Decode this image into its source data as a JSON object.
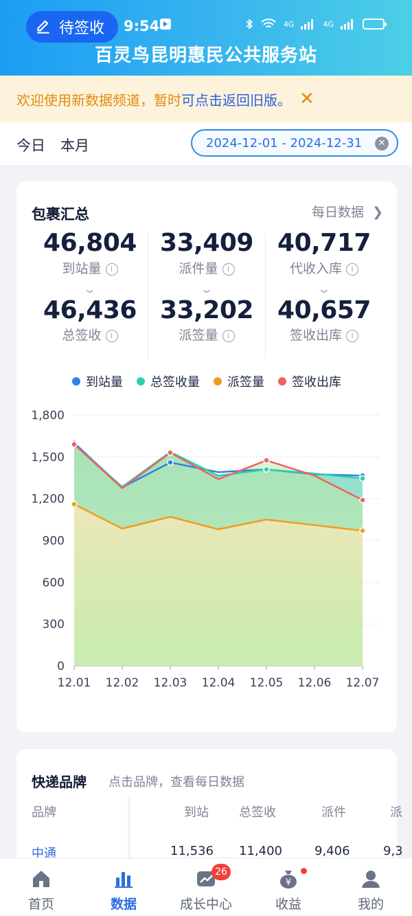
{
  "status_bar": {
    "pending_label": "待签收",
    "time": "9:54",
    "network_1": "4G",
    "network_2": "4G"
  },
  "header": {
    "title": "百灵鸟昆明惠民公共服务站"
  },
  "notice": {
    "text": "欢迎使用新数据频道，暂时",
    "link": "可点击返回旧版。",
    "close": "✕"
  },
  "date_filter": {
    "tab_today": "今日",
    "tab_month": "本月",
    "range": "2024-12-01 - 2024-12-31",
    "clear": "✕"
  },
  "summary": {
    "title": "包裹汇总",
    "daily_link": "每日数据",
    "stats": [
      {
        "value": "46,804",
        "label": "到站量"
      },
      {
        "value": "33,409",
        "label": "派件量"
      },
      {
        "value": "40,717",
        "label": "代收入库"
      },
      {
        "value": "46,436",
        "label": "总签收"
      },
      {
        "value": "33,202",
        "label": "派签量"
      },
      {
        "value": "40,657",
        "label": "签收出库"
      }
    ]
  },
  "colors": {
    "arrivals": "#2f7fe6",
    "total_signed": "#2ecfa8",
    "dispatch_signed": "#f29c1c",
    "signed_out": "#ee6363",
    "accent": "#2c6fde"
  },
  "chart_data": {
    "type": "area",
    "categories": [
      "12.01",
      "12.02",
      "12.03",
      "12.04",
      "12.05",
      "12.06",
      "12.07"
    ],
    "series": [
      {
        "name": "到站量",
        "values": [
          1600,
          1280,
          1460,
          1390,
          1410,
          1375,
          1365
        ]
      },
      {
        "name": "总签收量",
        "values": [
          1590,
          1285,
          1535,
          1365,
          1410,
          1380,
          1345
        ]
      },
      {
        "name": "派签量",
        "values": [
          1160,
          985,
          1070,
          980,
          1050,
          1010,
          970
        ]
      },
      {
        "name": "签收出库",
        "values": [
          1590,
          1275,
          1530,
          1340,
          1475,
          1365,
          1190
        ]
      }
    ],
    "ylim": [
      0,
      1800
    ],
    "yticks": [
      "0",
      "300",
      "600",
      "900",
      "1,200",
      "1,500",
      "1,800"
    ],
    "legend": "top-center",
    "grid": true
  },
  "brand": {
    "title": "快递品牌",
    "hint": "点击品牌，查看每日数据",
    "columns": [
      "品牌",
      "到站",
      "总签收",
      "派件",
      "派"
    ],
    "row": {
      "name": "中通",
      "arrivals": "11,536",
      "signed": "11,400",
      "dispatch": "9,406",
      "partial": "9,3"
    }
  },
  "nav": [
    {
      "label": "首页",
      "icon": "home-icon"
    },
    {
      "label": "数据",
      "icon": "bar-chart-icon"
    },
    {
      "label": "成长中心",
      "icon": "growth-icon",
      "badge": "26"
    },
    {
      "label": "收益",
      "icon": "money-bag-icon"
    },
    {
      "label": "我的",
      "icon": "user-icon"
    }
  ]
}
